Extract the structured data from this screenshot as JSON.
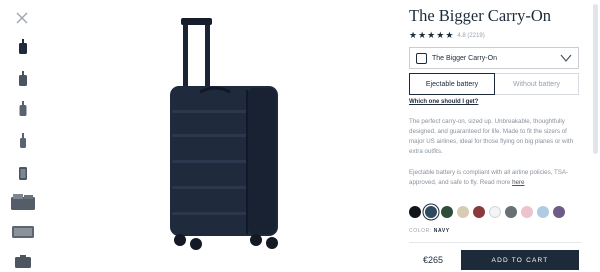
{
  "product": {
    "title": "The Bigger Carry-On",
    "rating_text": "4.8 (2219)",
    "stars": 5,
    "variant_select": {
      "value": "The Bigger Carry-On"
    },
    "battery_options": [
      "Ejectable battery",
      "Without battery"
    ],
    "selected_battery": "Ejectable battery",
    "help_link": "Which one should I get?",
    "description": "The perfect carry-on, sized up. Unbreakable, thoughtfully designed, and guaranteed for life. Made to fit the sizers of major US airlines, ideal for those flying on big planes or with extra outfits.",
    "battery_note": "Ejectable battery is compliant with all airline policies, TSA-approved, and safe to fly. Read more",
    "battery_note_link": "here",
    "color_label": "COLOR:",
    "color_value": "NAVY",
    "price": "€265",
    "cta": "ADD TO CART"
  },
  "swatches": [
    {
      "name": "black",
      "hex": "#111418",
      "selected": false
    },
    {
      "name": "navy",
      "hex": "#2f4a5c",
      "selected": true
    },
    {
      "name": "green",
      "hex": "#2f4d3a",
      "selected": false
    },
    {
      "name": "sand",
      "hex": "#d8cbb3",
      "selected": false
    },
    {
      "name": "maroon",
      "hex": "#8a3a3f",
      "selected": false
    },
    {
      "name": "white",
      "hex": "#f4f4f4",
      "selected": false
    },
    {
      "name": "grey",
      "hex": "#6a6f73",
      "selected": false
    },
    {
      "name": "pink",
      "hex": "#edc3cf",
      "selected": false
    },
    {
      "name": "light-blue",
      "hex": "#aecbe3",
      "selected": false
    },
    {
      "name": "purple",
      "hex": "#6b5b86",
      "selected": false
    }
  ],
  "thumbnails": [
    {
      "name": "front-view",
      "active": true
    },
    {
      "name": "angle-view",
      "active": false
    },
    {
      "name": "side-view",
      "active": false
    },
    {
      "name": "back-view",
      "active": false
    },
    {
      "name": "open-view",
      "active": false
    },
    {
      "name": "packed-view",
      "active": false
    },
    {
      "name": "interior-view",
      "active": false
    },
    {
      "name": "detail-view",
      "active": false
    }
  ],
  "colors": {
    "primary": "#1c2a3a",
    "muted": "#9aa2ab",
    "luggage": "#1f2a3d"
  },
  "icons": {
    "close": "close-icon",
    "chevron": "chevron-down-icon",
    "star": "star-icon"
  }
}
